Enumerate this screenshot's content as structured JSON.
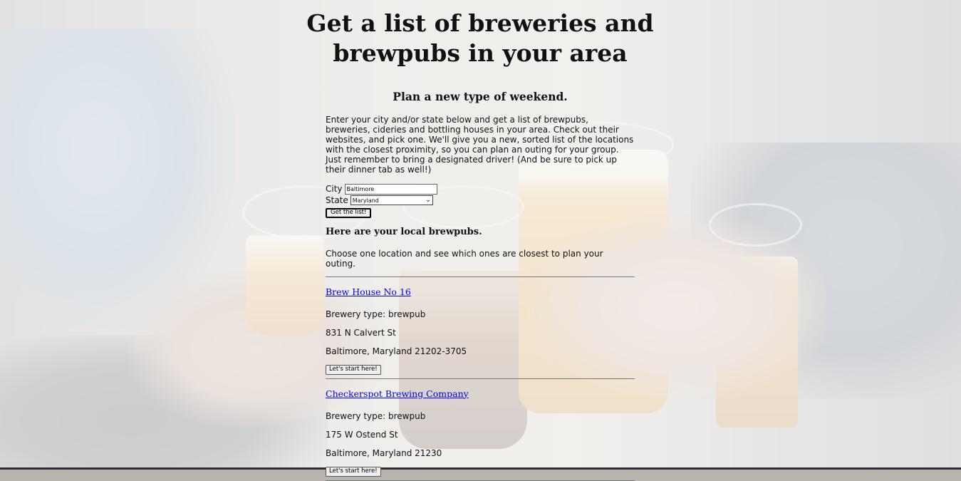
{
  "page": {
    "title": "Get a list of breweries and brewpubs in your area",
    "subtitle": "Plan a new type of weekend.",
    "intro": "Enter your city and/or state below and get a list of brewpubs, breweries, cideries and bottling houses in your area. Check out their websites, and pick one. We'll give you a new, sorted list of the locations with the closest proximity, so you can plan an outing for your group. Just remember to bring a designated driver! (And be sure to pick up their dinner tab as well!)"
  },
  "form": {
    "city_label": "City",
    "city_value": "Baltimore",
    "state_label": "State",
    "state_value": "Maryland",
    "submit_label": "Get the list!"
  },
  "results": {
    "heading": "Here are your local brewpubs.",
    "instruction": "Choose one location and see which ones are closest to plan your outing.",
    "breweries": [
      {
        "name": "Brew House No 16",
        "type": "Brewery type: brewpub",
        "street": "831 N Calvert St",
        "city_line": "Baltimore, Maryland 21202-3705",
        "button_label": "Let's start here!"
      },
      {
        "name": "Checkerspot Brewing Company",
        "type": "Brewery type: brewpub",
        "street": "175 W Ostend St",
        "city_line": "Baltimore, Maryland 21230",
        "button_label": "Let's start here!"
      }
    ]
  },
  "colors": {
    "link": "#0000ee",
    "text": "#111111",
    "bottom_bar": "#2b3137"
  }
}
